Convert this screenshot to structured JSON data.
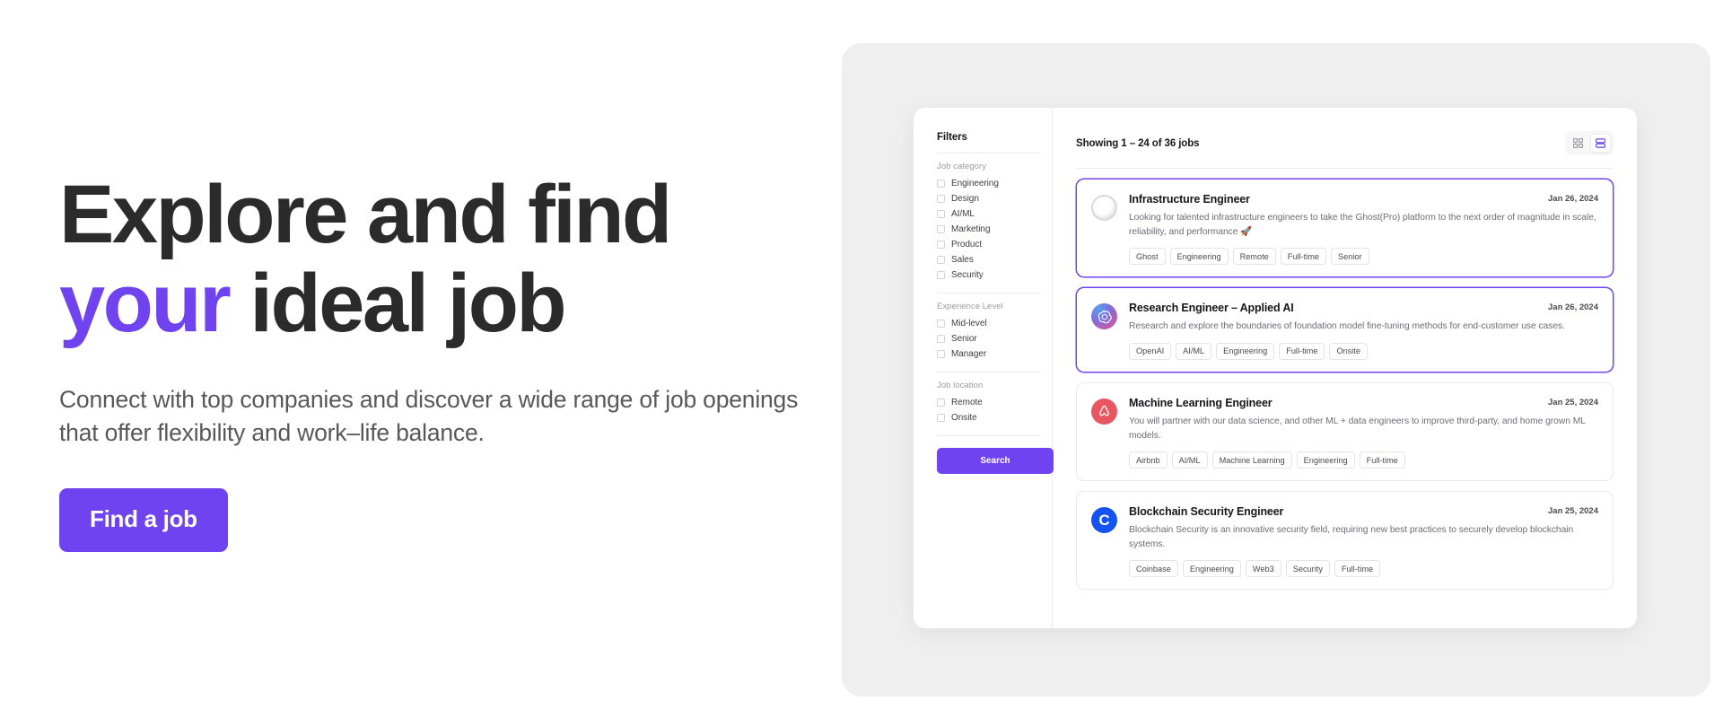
{
  "hero": {
    "title_line1": "Explore and find",
    "title_accent": "your",
    "title_line2_rest": " ideal job",
    "subtitle": "Connect with top companies and discover a wide range of job openings that offer flexibility and work–life balance.",
    "cta_label": "Find a job",
    "accent_color": "#6F44F0"
  },
  "filters": {
    "title": "Filters",
    "groups": [
      {
        "label": "Job category",
        "options": [
          "Engineering",
          "Design",
          "AI/ML",
          "Marketing",
          "Product",
          "Sales",
          "Security"
        ]
      },
      {
        "label": "Experience Level",
        "options": [
          "Mid-level",
          "Senior",
          "Manager"
        ]
      },
      {
        "label": "Job location",
        "options": [
          "Remote",
          "Onsite"
        ]
      }
    ],
    "search_label": "Search"
  },
  "list": {
    "showing": "Showing 1 – 24 of 36 jobs",
    "view_grid_icon": "grid-view-icon",
    "view_list_icon": "list-view-icon",
    "active_view": "list"
  },
  "jobs": [
    {
      "title": "Infrastructure Engineer",
      "date": "Jan 26, 2024",
      "description": "Looking for talented infrastructure engineers to take the Ghost(Pro) platform to the next order of magnitude in scale, reliability, and performance 🚀",
      "tags": [
        "Ghost",
        "Engineering",
        "Remote",
        "Full-time",
        "Senior"
      ],
      "logo": "ghost-logo",
      "logo_text": "",
      "selected": true
    },
    {
      "title": "Research Engineer – Applied AI",
      "date": "Jan 26, 2024",
      "description": "Research and explore the boundaries of foundation model fine-tuning methods for end-customer use cases.",
      "tags": [
        "OpenAI",
        "AI/ML",
        "Engineering",
        "Full-time",
        "Onsite"
      ],
      "logo": "openai-logo",
      "logo_text": "",
      "selected": true
    },
    {
      "title": "Machine Learning Engineer",
      "date": "Jan 25, 2024",
      "description": "You will partner with our data science, and other ML + data engineers to improve third-party, and home grown ML models.",
      "tags": [
        "Airbnb",
        "AI/ML",
        "Machine Learning",
        "Engineering",
        "Full-time"
      ],
      "logo": "airbnb-logo",
      "logo_text": "",
      "selected": false
    },
    {
      "title": "Blockchain Security Engineer",
      "date": "Jan 25, 2024",
      "description": "Blockchain Security is an innovative security field, requiring new best practices to securely develop blockchain systems.",
      "tags": [
        "Coinbase",
        "Engineering",
        "Web3",
        "Security",
        "Full-time"
      ],
      "logo": "coinbase-logo",
      "logo_text": "C",
      "selected": false
    }
  ]
}
